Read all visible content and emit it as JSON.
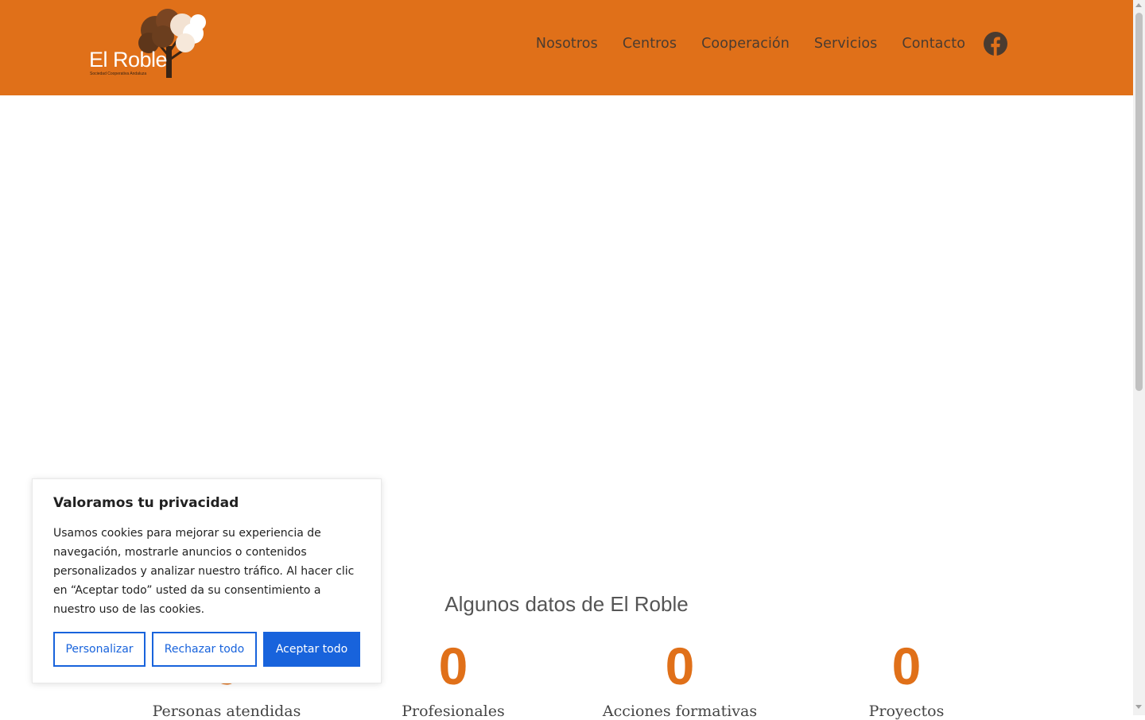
{
  "colors": {
    "brand": "#E07019",
    "accent_button": "#1863dc"
  },
  "header": {
    "logo": {
      "title": "El Roble",
      "subtitle": "Sociedad Cooperativa Andaluza"
    },
    "nav": [
      {
        "label": "Nosotros"
      },
      {
        "label": "Centros"
      },
      {
        "label": "Cooperación"
      },
      {
        "label": "Servicios"
      },
      {
        "label": "Contacto"
      }
    ],
    "social_icon": "facebook-icon"
  },
  "stats": {
    "title": "Algunos datos de El Roble",
    "items": [
      {
        "value": "0",
        "label": "Personas atendidas"
      },
      {
        "value": "0",
        "label": "Profesionales"
      },
      {
        "value": "0",
        "label": "Acciones formativas"
      },
      {
        "value": "0",
        "label": "Proyectos"
      }
    ]
  },
  "cookie_banner": {
    "title": "Valoramos tu privacidad",
    "text": "Usamos cookies para mejorar su experiencia de navegación, mostrarle anuncios o contenidos personalizados y analizar nuestro tráfico. Al hacer clic en “Aceptar todo” usted da su consentimiento a nuestro uso de las cookies.",
    "buttons": {
      "customize": "Personalizar",
      "reject": "Rechazar todo",
      "accept": "Aceptar todo"
    }
  }
}
